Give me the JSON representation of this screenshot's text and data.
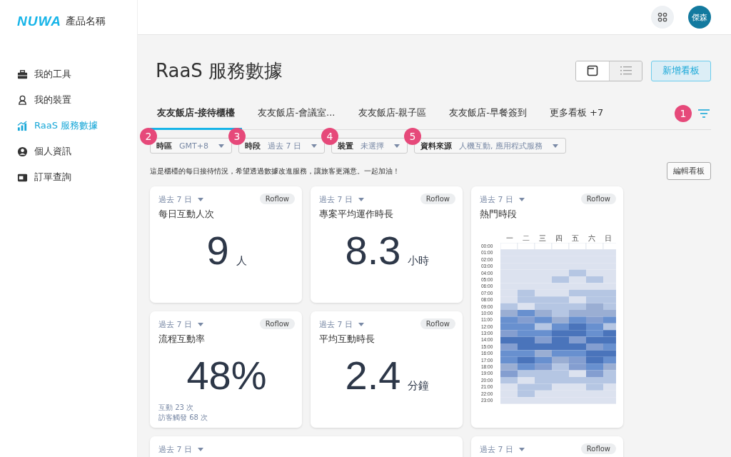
{
  "brand": {
    "logo": "NUWA",
    "product": "產品名稱"
  },
  "topbar": {
    "avatar": "傑森"
  },
  "sidebar": {
    "items": [
      {
        "kind": "tools",
        "label": "我的工具",
        "selected": false
      },
      {
        "kind": "device",
        "label": "我的裝置",
        "selected": false
      },
      {
        "kind": "chart",
        "label": "RaaS 服務數據",
        "selected": true
      },
      {
        "kind": "person",
        "label": "個人資訊",
        "selected": false
      },
      {
        "kind": "order",
        "label": "訂單查詢",
        "selected": false
      }
    ]
  },
  "page": {
    "title": "RaaS 服務數據",
    "view_toggle": [
      {
        "kind": "card",
        "selected": true
      },
      {
        "kind": "list",
        "selected": false
      }
    ],
    "add_button": "新增看板"
  },
  "tabs": [
    {
      "label": "友友飯店-接待櫃檯",
      "selected": true
    },
    {
      "label": "友友飯店-會議室...",
      "selected": false
    },
    {
      "label": "友友飯店-親子區",
      "selected": false
    },
    {
      "label": "友友飯店-早餐簽到",
      "selected": false
    },
    {
      "label": "更多看板 +7",
      "selected": false
    }
  ],
  "filter_badge": "1",
  "filters": [
    {
      "badge": "2",
      "label": "時區",
      "value": "GMT+8"
    },
    {
      "badge": "3",
      "label": "時段",
      "value": "過去 7 日"
    },
    {
      "badge": "4",
      "label": "裝置",
      "value": "未選擇"
    },
    {
      "badge": "5",
      "label": "資料來源",
      "value": "人機互動, 應用程式服務"
    }
  ],
  "description": "這是櫃檯的每日接待情況，希望透過數據改進服務，讓旅客更滿意。一起加油！",
  "edit_button": "編輯看板",
  "cards": [
    {
      "kind": "metric",
      "period": "過去 7 日",
      "tag": "Roflow",
      "title": "每日互動人次",
      "value": "9",
      "unit": "人"
    },
    {
      "kind": "metric",
      "period": "過去 7 日",
      "tag": "Roflow",
      "title": "專案平均運作時長",
      "value": "8.3",
      "unit": "小時"
    },
    {
      "kind": "heatmap",
      "period": "過去 7 日",
      "tag": "Roflow",
      "title": "熱門時段",
      "days": [
        "一",
        "二",
        "三",
        "四",
        "五",
        "六",
        "日"
      ],
      "hours": [
        "00:00",
        "01:00",
        "02:00",
        "03:00",
        "04:00",
        "05:00",
        "06:00",
        "07:00",
        "08:00",
        "09:00",
        "10:00",
        "11:00",
        "12:00",
        "13:00",
        "14:00",
        "15:00",
        "16:00",
        "17:00",
        "18:00",
        "19:00",
        "20:00",
        "21:00",
        "22:00",
        "23:00"
      ]
    },
    {
      "kind": "metric",
      "period": "過去 7 日",
      "tag": "Roflow",
      "title": "流程互動率",
      "value": "48%",
      "notes": [
        "互動 23 次",
        "訪客觸發 68 次"
      ]
    },
    {
      "kind": "metric",
      "period": "過去 7 日",
      "tag": "Roflow",
      "title": "平均互動時長",
      "value": "2.4",
      "unit": "分鐘"
    },
    {
      "kind": "wide-stub",
      "period": "過去 7 日"
    },
    {
      "kind": "stub",
      "period": "過去 7 日",
      "tag": "Roflow"
    }
  ]
}
